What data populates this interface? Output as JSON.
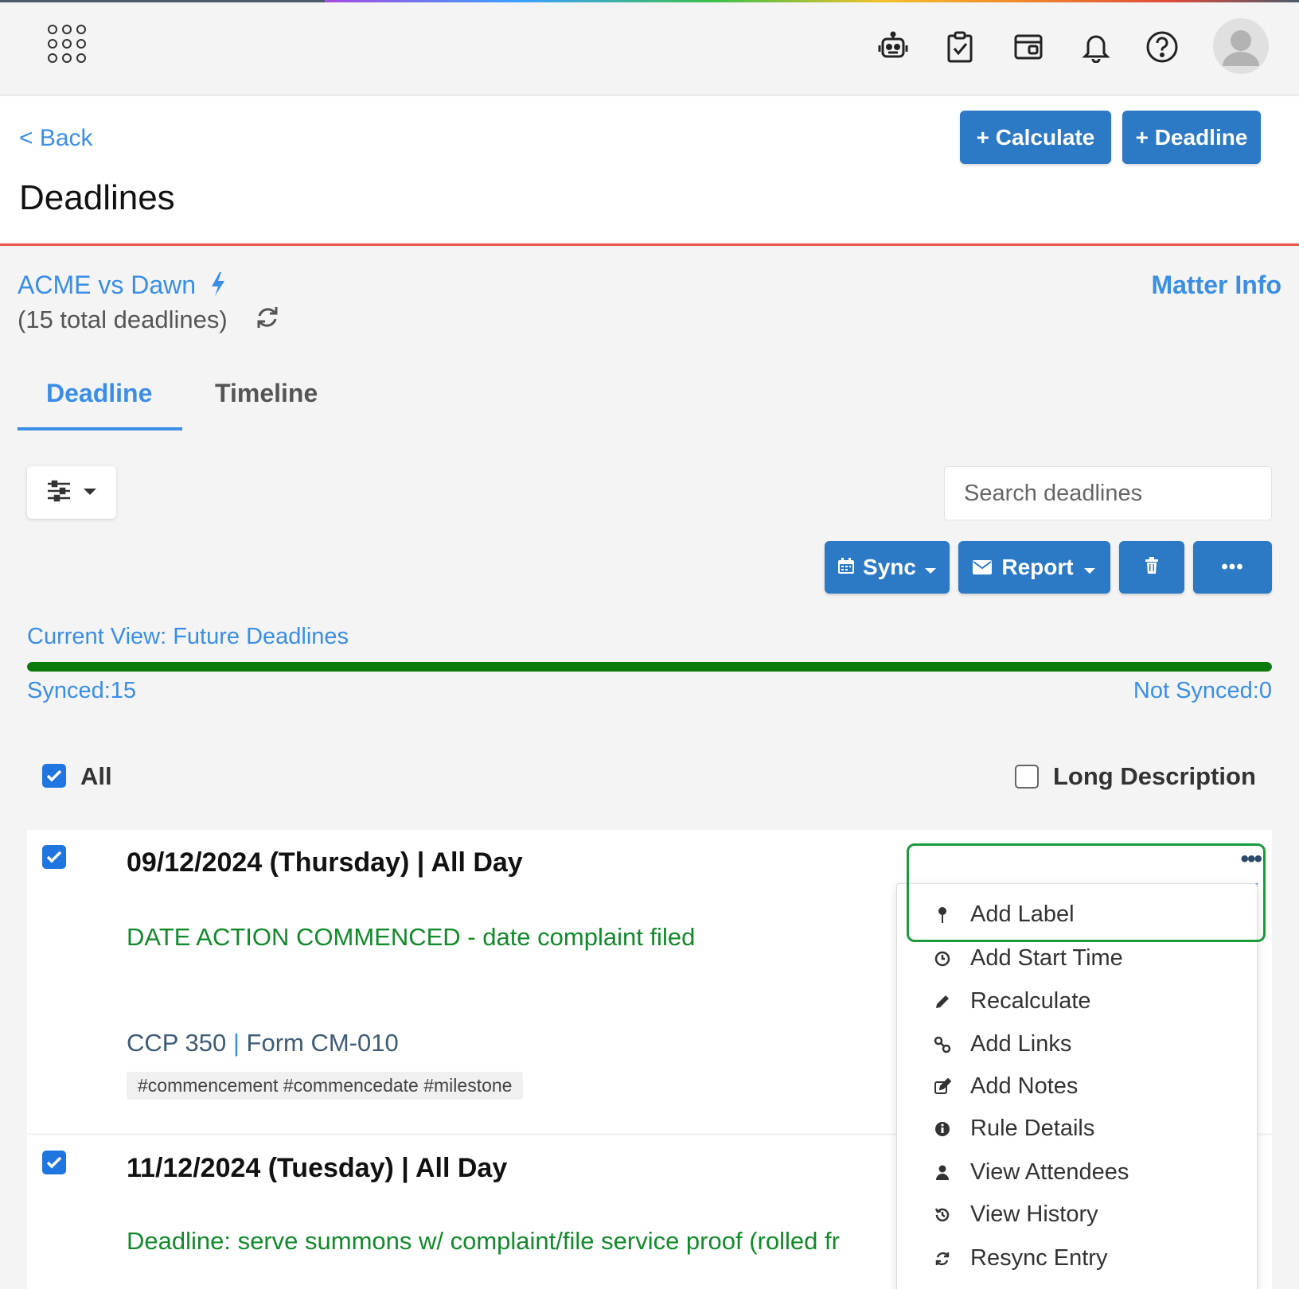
{
  "topbar": {
    "icons": [
      "apps-grid-icon",
      "robot-icon",
      "clipboard-check-icon",
      "wallet-icon",
      "bell-icon",
      "help-icon",
      "user-avatar"
    ]
  },
  "header": {
    "back_label": "< Back",
    "title": "Deadlines",
    "calculate_label": "+ Calculate",
    "deadline_label": "+ Deadline"
  },
  "matter": {
    "name": "ACME vs Dawn",
    "total": "(15 total deadlines)",
    "info_label": "Matter Info"
  },
  "tabs": [
    {
      "label": "Deadline",
      "active": true
    },
    {
      "label": "Timeline",
      "active": false
    }
  ],
  "toolbar": {
    "search_placeholder": "Search deadlines",
    "sync_label": "Sync",
    "report_label": "Report",
    "more_label": "•••"
  },
  "view": {
    "current": "Current View: Future Deadlines",
    "synced": "Synced:15",
    "not_synced": "Not Synced:0",
    "synced_fraction": 1.0,
    "progress_color": "#0a7a0a"
  },
  "options": {
    "all_label": "All",
    "all_checked": true,
    "long_desc_label": "Long Description",
    "long_desc_checked": false
  },
  "deadlines": [
    {
      "date": "09/12/2024 (Thursday)",
      "time": "All Day",
      "title": "DATE ACTION COMMENCED - date complaint filed",
      "rule": "CCP 350",
      "form": "Form CM-010",
      "tags": "#commencement #commencedate #milestone",
      "checked": true
    },
    {
      "date": "11/12/2024 (Tuesday)",
      "time": "All Day",
      "title": "Deadline: serve summons w/ complaint/file service proof (rolled fr",
      "checked": true
    }
  ],
  "menu": {
    "more_label": "•••",
    "items": [
      {
        "label": "Add Label",
        "icon": "pin-icon"
      },
      {
        "label": "Add Start Time",
        "icon": "clock-icon"
      },
      {
        "label": "Recalculate",
        "icon": "pencil-icon"
      },
      {
        "label": "Add Links",
        "icon": "link-icon"
      },
      {
        "label": "Add Notes",
        "icon": "edit-icon"
      },
      {
        "label": "Rule Details",
        "icon": "info-icon"
      },
      {
        "label": "View Attendees",
        "icon": "user-icon"
      },
      {
        "label": "View History",
        "icon": "history-icon"
      },
      {
        "label": "Resync Entry",
        "icon": "refresh-icon"
      }
    ]
  },
  "colors": {
    "accent": "#3a8ee6",
    "button": "#2c79c5",
    "title_green": "#118a2a",
    "header_border": "#e8534a",
    "highlight": "#1a9a3a"
  }
}
